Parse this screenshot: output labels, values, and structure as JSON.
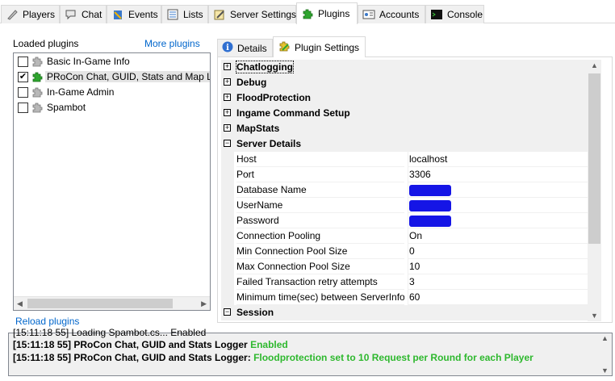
{
  "tabs": [
    {
      "label": "Players",
      "icon": "players-icon"
    },
    {
      "label": "Chat",
      "icon": "chat-icon"
    },
    {
      "label": "Events",
      "icon": "events-icon"
    },
    {
      "label": "Lists",
      "icon": "lists-icon"
    },
    {
      "label": "Server Settings",
      "icon": "server-settings-icon"
    },
    {
      "label": "Plugins",
      "icon": "plugin-icon",
      "active": true
    },
    {
      "label": "Accounts",
      "icon": "accounts-icon"
    },
    {
      "label": "Console",
      "icon": "console-icon"
    }
  ],
  "plugins_panel": {
    "loaded_label": "Loaded plugins",
    "more_link": "More plugins",
    "reload_link": "Reload plugins",
    "items": [
      {
        "label": "Basic In-Game Info",
        "checked": false
      },
      {
        "label": "PRoCon Chat, GUID, Stats and Map Logger",
        "checked": true,
        "selected": true
      },
      {
        "label": "In-Game Admin",
        "checked": false
      },
      {
        "label": "Spambot",
        "checked": false
      }
    ]
  },
  "inner_tabs": {
    "details": "Details",
    "settings": "Plugin Settings"
  },
  "property_grid": {
    "categories": {
      "chatlogging": "Chatlogging",
      "debug": "Debug",
      "flood": "FloodProtection",
      "ingame": "Ingame Command Setup",
      "mapstats": "MapStats",
      "server": "Server Details",
      "session": "Session"
    },
    "properties": [
      {
        "name": "Host",
        "value": "localhost"
      },
      {
        "name": "Port",
        "value": "3306"
      },
      {
        "name": "Database Name",
        "value": ""
      },
      {
        "name": "UserName",
        "value": ""
      },
      {
        "name": "Password",
        "value": ""
      },
      {
        "name": "Connection Pooling",
        "value": "On"
      },
      {
        "name": "Min Connection Pool Size",
        "value": "0"
      },
      {
        "name": "Max Connection Pool Size",
        "value": "10"
      },
      {
        "name": "Failed Transaction retry attempts",
        "value": "3"
      },
      {
        "name": "Minimum time(sec) between ServerInfo",
        "value": "60"
      }
    ]
  },
  "console": {
    "partial": "[15:11:18 55] Loading Spambot.cs... Enabled",
    "line1_prefix": "[15:11:18 55] PRoCon Chat, GUID and Stats Logger",
    "line1_status": "Enabled",
    "line2_prefix": "[15:11:18 55] PRoCon Chat, GUID and Stats Logger:",
    "line2_msg": "Floodprotection set to 10 Request per Round for each Player"
  },
  "colors": {
    "link": "#0066cc",
    "log_green": "#2eb82e",
    "redaction": "#1515e6"
  }
}
